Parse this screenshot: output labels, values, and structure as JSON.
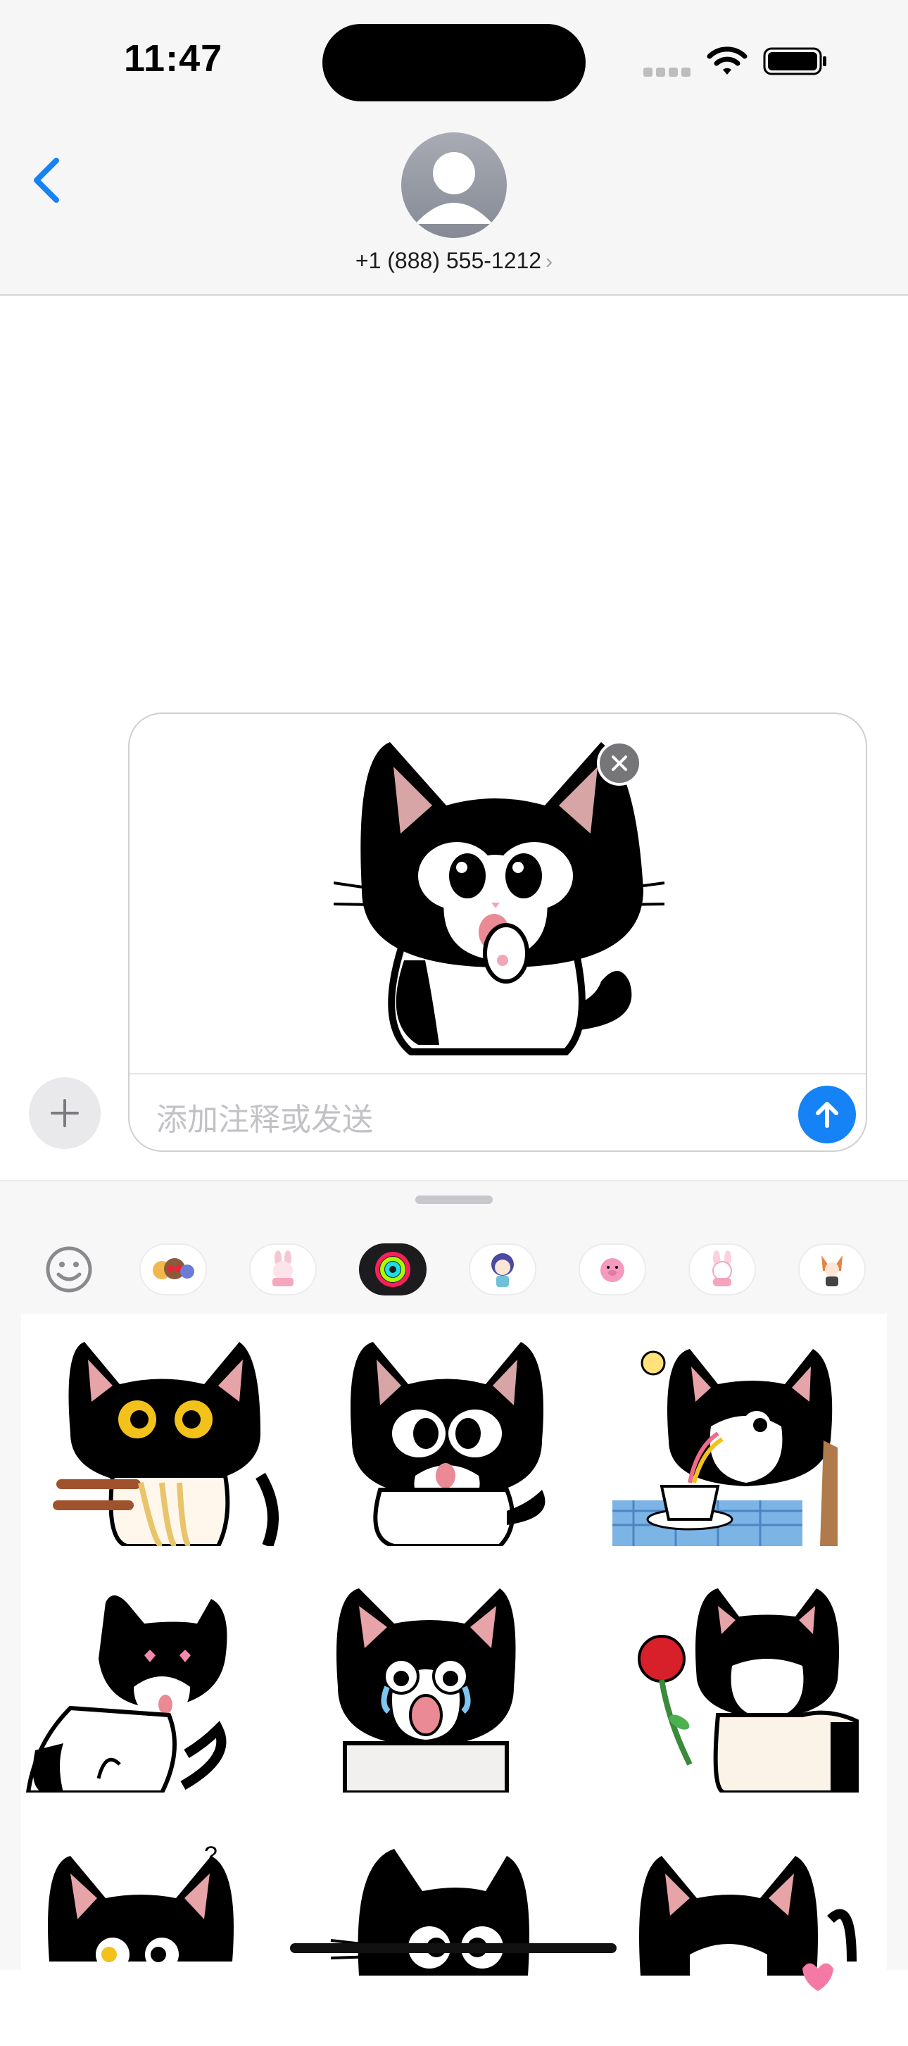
{
  "status_bar": {
    "time": "11:47"
  },
  "header": {
    "contact": "+1 (888) 555-1212",
    "contact_chevron": "›"
  },
  "compose": {
    "placeholder": "添加注释或发送"
  },
  "icons": {
    "back": "chevron-left-icon",
    "avatar": "person-icon",
    "plus": "plus-icon",
    "send": "arrow-up-icon",
    "remove": "close-icon"
  },
  "sticker_tabs": [
    "emoji",
    "memoji",
    "bunny-sticker-pack",
    "activity-rings",
    "anime-girl-sticker-pack",
    "pink-pig-sticker-pack",
    "pink-bunny-sticker-pack",
    "fox-girl-sticker-pack"
  ],
  "selected_tab_index": 3,
  "sticker_grid": [
    "cat-eating-noodles",
    "cat-licking-paw",
    "cat-with-coffee-idea",
    "cat-heart-eyes",
    "cat-crying-shocked",
    "cat-with-rose",
    "cat-confused",
    "cat-surprised",
    "cat-with-hearts"
  ],
  "colors": {
    "accent": "#1582f5",
    "header_bg": "#f6f6f6",
    "drawer_bg": "#f7f7f8"
  }
}
